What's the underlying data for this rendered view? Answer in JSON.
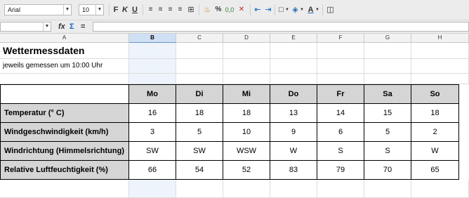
{
  "toolbar": {
    "font_name": "Arial",
    "font_size": "10",
    "bold_label": "F",
    "italic_label": "K",
    "underline_label": "U",
    "percent_label": "%",
    "decimal_label": "0,0",
    "font_color_label": "A"
  },
  "formula_bar": {
    "name_box_value": "",
    "fx_label": "fx",
    "sum_label": "Σ",
    "equals_label": "=",
    "input_value": ""
  },
  "columns": [
    "A",
    "B",
    "C",
    "D",
    "E",
    "F",
    "G",
    "H"
  ],
  "selected_column": "B",
  "sheet": {
    "title": "Wettermessdaten",
    "subtitle": "jeweils gemessen um 10:00 Uhr",
    "table": {
      "days": [
        "Mo",
        "Di",
        "Mi",
        "Do",
        "Fr",
        "Sa",
        "So"
      ],
      "rows": [
        {
          "label": "Temperatur (° C)",
          "values": [
            "16",
            "18",
            "18",
            "13",
            "14",
            "15",
            "18"
          ]
        },
        {
          "label": "Windgeschwindigkeit (km/h)",
          "values": [
            "3",
            "5",
            "10",
            "9",
            "6",
            "5",
            "2"
          ]
        },
        {
          "label": "Windrichtung (Himmelsrichtung)",
          "values": [
            "SW",
            "SW",
            "WSW",
            "W",
            "S",
            "S",
            "W"
          ]
        },
        {
          "label": "Relative Luftfeuchtigkeit (%)",
          "values": [
            "66",
            "54",
            "52",
            "83",
            "79",
            "70",
            "65"
          ]
        }
      ]
    }
  },
  "colors": {
    "header_fill": "#d5d5d5",
    "selected_column_fill": "#cfe0f4",
    "grid_line": "#dcdcdc"
  }
}
